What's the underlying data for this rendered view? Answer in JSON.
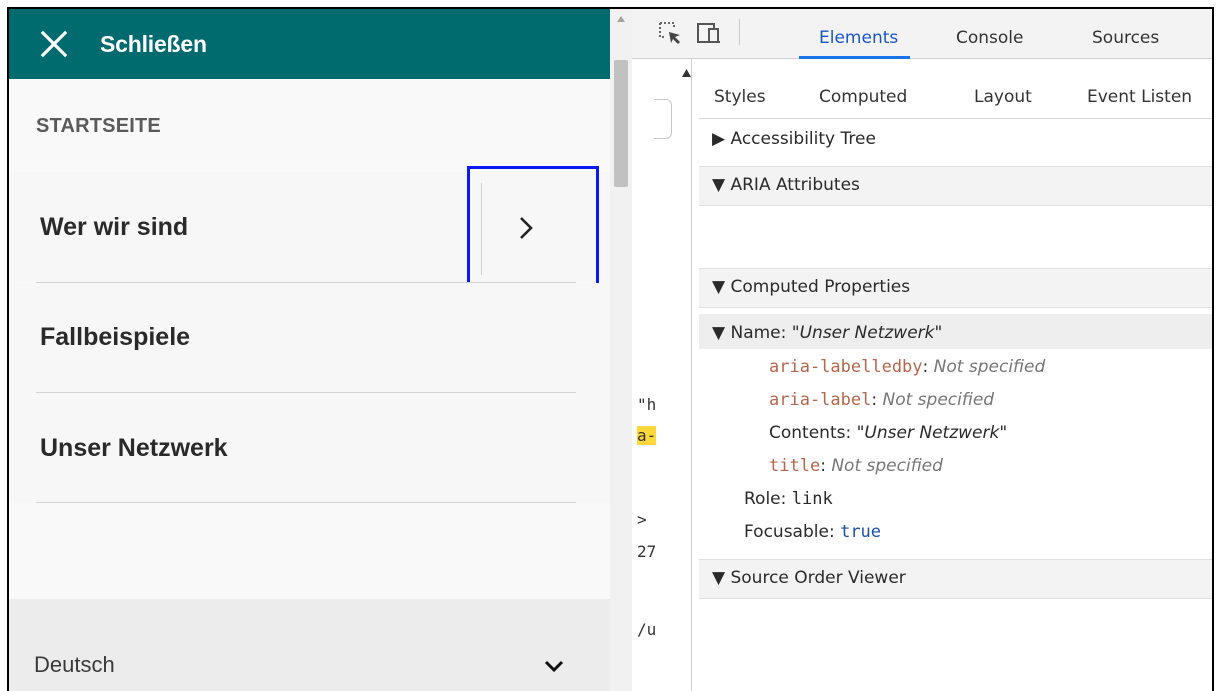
{
  "menu": {
    "close_label": "Schließen",
    "startseite": "STARTSEITE",
    "items": [
      {
        "label": "Wer wir sind"
      },
      {
        "label": "Fallbeispiele"
      },
      {
        "label": "Unser Netzwerk"
      }
    ],
    "language": "Deutsch"
  },
  "elements_fragments": [
    "\"h",
    "a-",
    ">",
    "27",
    "/u"
  ],
  "devtools": {
    "tabs": [
      "Elements",
      "Console",
      "Sources"
    ],
    "active_tab": "Elements",
    "subtabs": [
      "Styles",
      "Computed",
      "Layout",
      "Event Listen"
    ],
    "sections": {
      "accessibility_tree": "Accessibility Tree",
      "aria_attributes": "ARIA Attributes",
      "computed_properties": "Computed Properties",
      "source_order_viewer": "Source Order Viewer"
    },
    "name_prefix": "Name: ",
    "name_value": "\"Unser Netzwerk\"",
    "aria_labelledby": "aria-labelledby",
    "aria_label": "aria-label",
    "title": "title",
    "not_specified": "Not specified",
    "contents_prefix": "Contents: ",
    "contents_value": "\"Unser Netzwerk\"",
    "role_prefix": "Role: ",
    "role_value": "link",
    "focusable_prefix": "Focusable: ",
    "focusable_value": "true"
  },
  "colors": {
    "header_teal": "#006b6e",
    "focus_outline": "#0a19f5",
    "active_tab": "#1a73e8"
  }
}
